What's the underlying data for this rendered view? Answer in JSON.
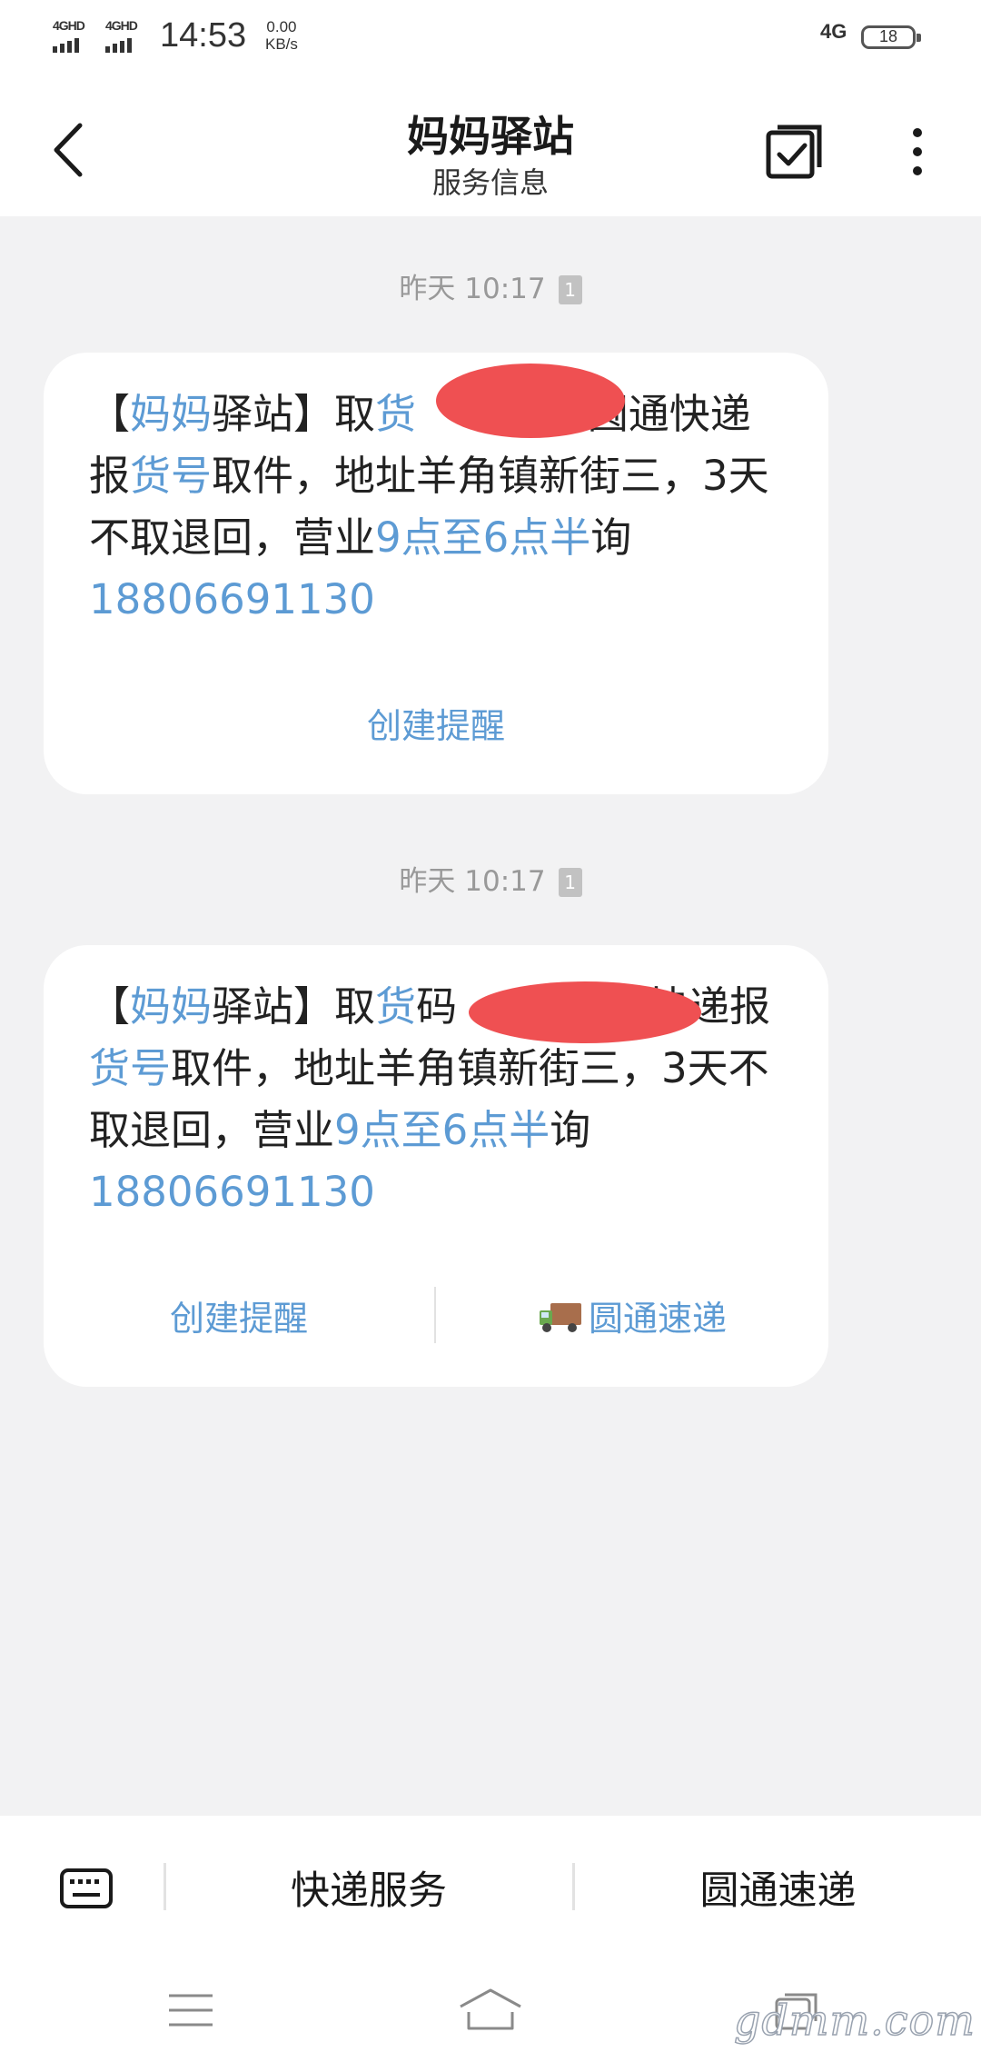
{
  "status_bar": {
    "network_1": "4GHD",
    "network_2": "4GHD",
    "time": "14:53",
    "speed_value": "0.00",
    "speed_unit": "KB/s",
    "mobile_data": "4G",
    "battery": "18"
  },
  "header": {
    "title": "妈妈驿站",
    "subtitle": "服务信息"
  },
  "messages": [
    {
      "timestamp": "昨天 10:17",
      "sim": "1",
      "text_parts": [
        "【",
        "妈妈",
        "驿站】取",
        "货",
        "3圆通快递报",
        "货号",
        "取件，地址羊角镇新街三，3天不取退回，营业",
        "9点至6点半",
        "询",
        "18806691130"
      ],
      "actions": [
        "创建提醒"
      ]
    },
    {
      "timestamp": "昨天 10:17",
      "sim": "1",
      "text_parts": [
        "【",
        "妈妈",
        "驿站】取",
        "货",
        "码",
        "通快递报",
        "货号",
        "取件，地址羊角镇新街三，3天不取退回，营业",
        "9点至6点半",
        "询",
        "18806691130"
      ],
      "actions": [
        "创建提醒",
        "圆通速递"
      ]
    }
  ],
  "bottom_bar": {
    "menu_1": "快递服务",
    "menu_2": "圆通速递"
  },
  "watermark": "gdmm.com",
  "colors": {
    "link": "#5d9bd4",
    "redaction": "#ef5052",
    "background": "#f2f2f3"
  }
}
